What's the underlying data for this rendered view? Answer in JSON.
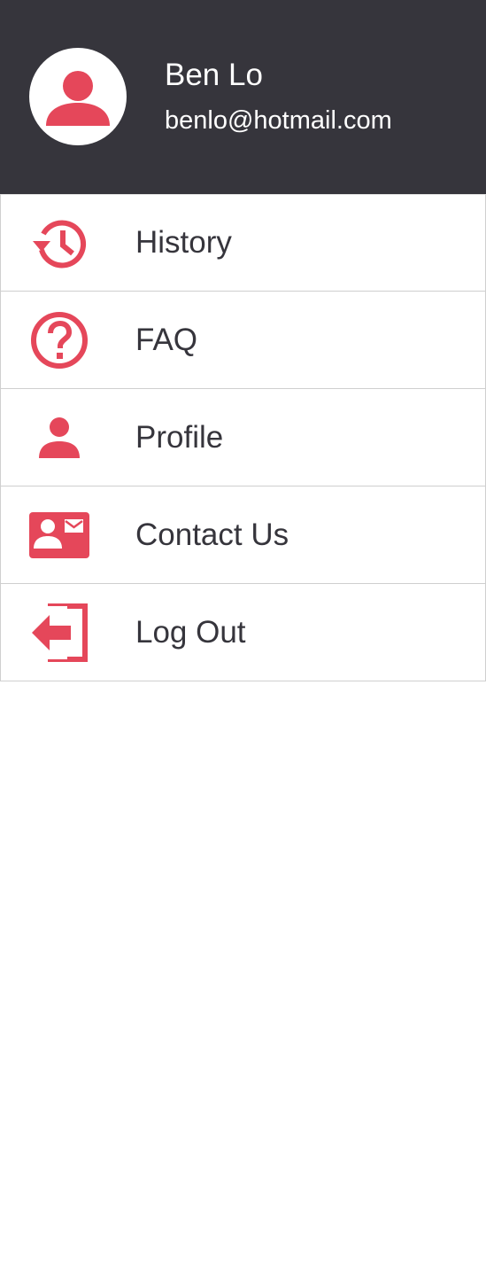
{
  "theme": {
    "accent": "#e5475a",
    "header_bg": "#36353c",
    "text": "#36353c",
    "divider": "#cfcfcf"
  },
  "user": {
    "name": "Ben Lo",
    "email": "benlo@hotmail.com",
    "avatar_icon": "person-icon"
  },
  "menu": {
    "items": [
      {
        "label": "History",
        "icon": "history-icon"
      },
      {
        "label": "FAQ",
        "icon": "question-circle-icon"
      },
      {
        "label": "Profile",
        "icon": "person-icon"
      },
      {
        "label": "Contact Us",
        "icon": "contact-card-icon"
      },
      {
        "label": "Log Out",
        "icon": "logout-icon"
      }
    ]
  }
}
